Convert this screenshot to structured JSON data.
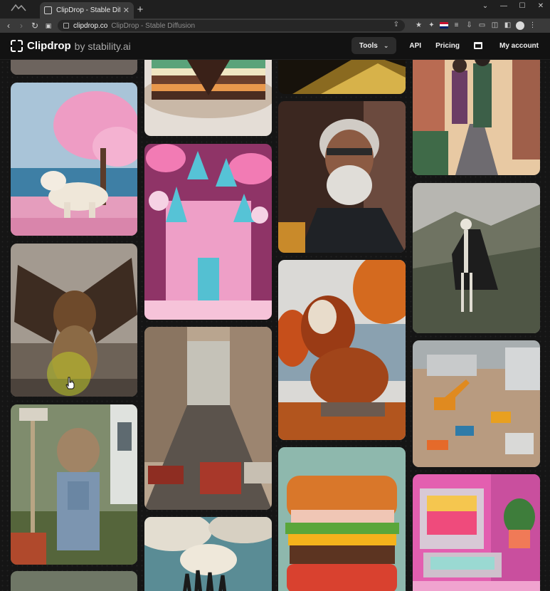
{
  "browser": {
    "tab_title": "ClipDrop - Stable Diffusion",
    "tab_close": "✕",
    "new_tab": "+",
    "window_buttons": [
      "⌄",
      "—",
      "☐",
      "✕"
    ],
    "url_host": "clipdrop.co",
    "url_rest": "ClipDrop - Stable Diffusion",
    "nav": {
      "back": "‹",
      "forward": "›",
      "reload": "↻"
    }
  },
  "header": {
    "brand": "Clipdrop",
    "brand_sub": "by stability.ai",
    "tools_label": "Tools",
    "api_label": "API",
    "pricing_label": "Pricing",
    "account_label": "My account"
  },
  "colors": {
    "page_bg": "#151515",
    "header_bg": "#121212",
    "chrome_bg": "#3a3a3a",
    "tools_btn_bg": "#2c2c2c",
    "cursor_halo": "#bec828"
  },
  "gallery": {
    "columns": 4,
    "cards": [
      {
        "id": "partial-top-col1",
        "subject": "cropped image"
      },
      {
        "id": "polar-bear",
        "subject": "polar bear under a pink cherry blossom tree"
      },
      {
        "id": "winged-lion",
        "subject": "lion with eagle wings on a rock"
      },
      {
        "id": "farmer-cat",
        "subject": "cat in overalls holding a shovel"
      },
      {
        "id": "partial-bottom-col1",
        "subject": "cropped image"
      },
      {
        "id": "layer-cake",
        "subject": "slice of layered cake"
      },
      {
        "id": "candy-castle",
        "subject": "pink candy castle with lollipops"
      },
      {
        "id": "city-street",
        "subject": "retro city street with cars"
      },
      {
        "id": "clouds-hands",
        "subject": "hands reaching toward clouds"
      },
      {
        "id": "partial-top-col3",
        "subject": "dark golden image"
      },
      {
        "id": "old-man",
        "subject": "old man with glasses and beard"
      },
      {
        "id": "autumn-lion",
        "subject": "lion made of autumn leaves"
      },
      {
        "id": "sandwich",
        "subject": "giant burger sandwich"
      },
      {
        "id": "anime-couple",
        "subject": "anime couple walking down a street"
      },
      {
        "id": "skeleton",
        "subject": "skeleton in a cloak on a foggy hill"
      },
      {
        "id": "construction",
        "subject": "miniature construction site"
      },
      {
        "id": "retro-computer",
        "subject": "pastel retro computer with plant"
      }
    ]
  }
}
